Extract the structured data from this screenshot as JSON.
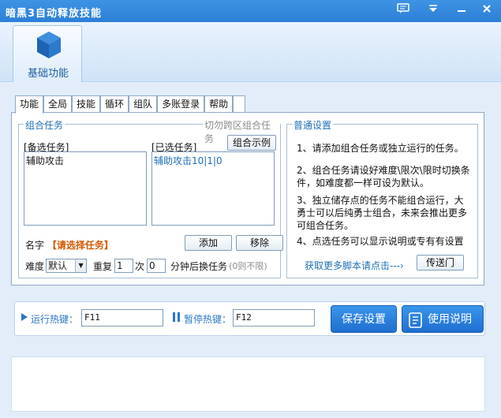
{
  "window": {
    "title": "暗黑3自动释放技能"
  },
  "ribbon": {
    "tab_label": "基础功能"
  },
  "tabs": [
    "功能",
    "全局",
    "技能",
    "循环",
    "组队",
    "多账登录",
    "帮助",
    ""
  ],
  "combo": {
    "legend": "组合任务",
    "cross_label": "切勿跨区组合任务",
    "available_label": "[备选任务]",
    "selected_label": "[已选任务]",
    "example_button": "组合示例",
    "available_items": [
      "辅助攻击"
    ],
    "selected_items": [
      "辅助攻击10|1|0"
    ],
    "name_label": "名字",
    "name_value": "【请选择任务】",
    "add_button": "添加",
    "remove_button": "移除",
    "difficulty_label": "难度",
    "difficulty_value": "默认",
    "repeat_label": "重复",
    "repeat_value": "1",
    "times_label": "次",
    "minutes_value": "0",
    "minutes_label": "分钟后换任务",
    "unlimited_note": "(0则不限)"
  },
  "normal": {
    "legend": "普通设置",
    "info1": "1、请添加组合任务或独立运行的任务。",
    "info2": "2、组合任务请设好难度\\限次\\限时切换条件，如难度都一样可设为默认。",
    "info3": "3、独立储存点的任务不能组合运行，大勇士可以后纯勇士组合，未来会推出更多可组合任务。",
    "info4": "4、点选任务可以显示说明或专有有设置",
    "more_link": "获取更多脚本请点击---›",
    "portal_button": "传送门"
  },
  "hotkeys": {
    "run_label": "运行热键：",
    "run_value": "F11",
    "pause_label": "暂停热键：",
    "pause_value": "F12",
    "save_button": "保存设置",
    "help_button": "使用说明"
  }
}
